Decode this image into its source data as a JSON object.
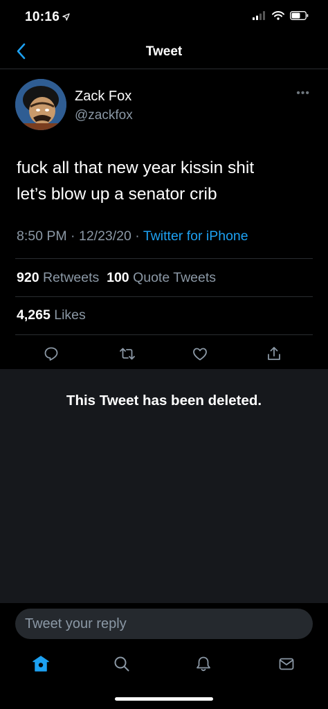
{
  "status_bar": {
    "time": "10:16"
  },
  "nav": {
    "title": "Tweet"
  },
  "author": {
    "name": "Zack Fox",
    "handle": "@zackfox"
  },
  "tweet": {
    "lines": [
      "fuck all that new year kissin shit",
      "let’s blow up a senator crib"
    ],
    "time": "8:50 PM",
    "date": "12/23/20",
    "source": "Twitter for iPhone",
    "separator": "·"
  },
  "stats": {
    "retweets_count": "920",
    "retweets_label": "Retweets",
    "quote_count": "100",
    "quote_label": "Quote Tweets",
    "likes_count": "4,265",
    "likes_label": "Likes"
  },
  "deleted": {
    "message": "This Tweet has been deleted."
  },
  "reply": {
    "placeholder": "Tweet your reply"
  },
  "colors": {
    "accent": "#1da1f2",
    "background": "#000000",
    "panel": "#16181c",
    "secondary_text": "#8b98a5"
  },
  "icons": {
    "actions": [
      "reply-icon",
      "retweet-icon",
      "like-icon",
      "share-icon"
    ],
    "tabs": [
      "home-icon",
      "search-icon",
      "notifications-icon",
      "messages-icon"
    ]
  }
}
